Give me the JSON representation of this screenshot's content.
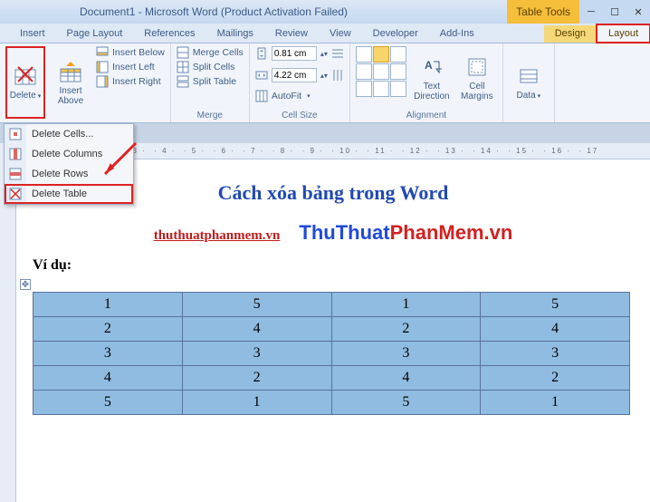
{
  "window": {
    "title": "Document1 - Microsoft Word (Product Activation Failed)",
    "table_tools_label": "Table Tools"
  },
  "tabs": {
    "insert": "Insert",
    "page_layout": "Page Layout",
    "references": "References",
    "mailings": "Mailings",
    "review": "Review",
    "view": "View",
    "developer": "Developer",
    "addins": "Add-Ins",
    "design": "Design",
    "layout": "Layout"
  },
  "ribbon": {
    "delete": "Delete",
    "insert_above": "Insert\nAbove",
    "insert_below": "Insert Below",
    "insert_left": "Insert Left",
    "insert_right": "Insert Right",
    "merge_cells": "Merge Cells",
    "split_cells": "Split Cells",
    "split_table": "Split Table",
    "group_merge": "Merge",
    "height_value": "0.81 cm",
    "width_value": "4.22 cm",
    "autofit": "AutoFit",
    "group_cellsize": "Cell Size",
    "text_direction": "Text\nDirection",
    "cell_margins": "Cell\nMargins",
    "group_alignment": "Alignment",
    "data": "Data"
  },
  "delete_menu": {
    "cells": "Delete Cells...",
    "columns": "Delete Columns",
    "rows": "Delete Rows",
    "table": "Delete Table"
  },
  "document": {
    "heading": "Cách xóa bảng trong Word",
    "sublink": "thuthuatphanmem.vn",
    "brand_a": "ThuThuat",
    "brand_b": "PhanMem.vn",
    "example_label": "Ví dụ:",
    "table": {
      "rows": [
        [
          "1",
          "5",
          "1",
          "5"
        ],
        [
          "2",
          "4",
          "2",
          "4"
        ],
        [
          "3",
          "3",
          "3",
          "3"
        ],
        [
          "4",
          "2",
          "4",
          "2"
        ],
        [
          "5",
          "1",
          "5",
          "1"
        ]
      ]
    }
  },
  "ruler_marks": "· 2 · 1 · ﻿ · 1 · ﻿ · 2 · ﻿ · 3 · ﻿ · 4 · ﻿ · 5 · ﻿ · 6 · ﻿ · 7 · ﻿ · 8 · ﻿ · 9 · ﻿ · 10 · ﻿ · 11 · ﻿ · 12 · ﻿ · 13 · ﻿ · 14 · ﻿ · 15 · ﻿ · 16 · ﻿ · 17"
}
